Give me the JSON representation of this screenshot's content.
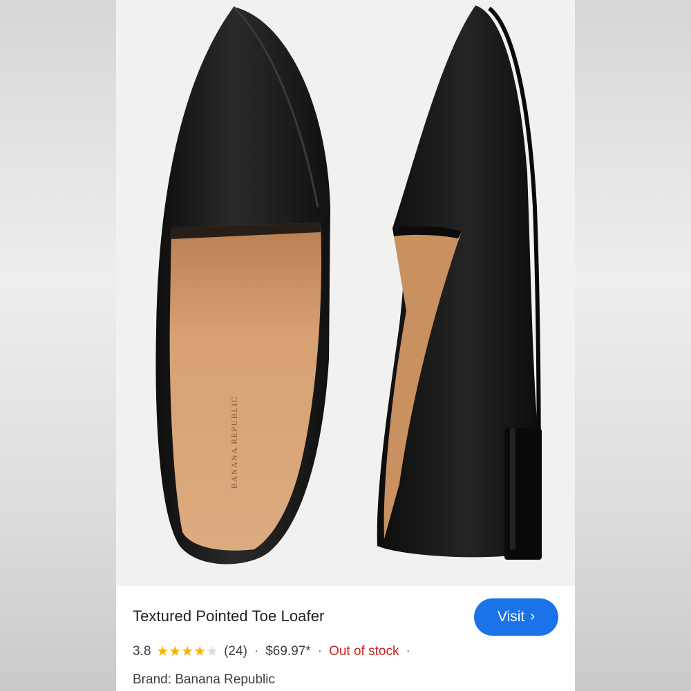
{
  "product": {
    "title": "Textured Pointed Toe Loafer",
    "rating_value": "3.8",
    "rating_stars": 3.8,
    "review_count": "(24)",
    "price": "$69.97*",
    "stock_status": "Out of stock",
    "brand_line": "Brand: Banana Republic",
    "insole_logo_text": "BANANA REPUBLIC"
  },
  "actions": {
    "visit_label": "Visit",
    "visit_icon": "chevron-right-icon"
  },
  "separators": {
    "dot": "·"
  },
  "colors": {
    "accent_button": "#1a73e8",
    "out_of_stock": "#c5221f",
    "star": "#f4b400",
    "shoe_leather": "#161616",
    "insole": "#d49a6a"
  }
}
